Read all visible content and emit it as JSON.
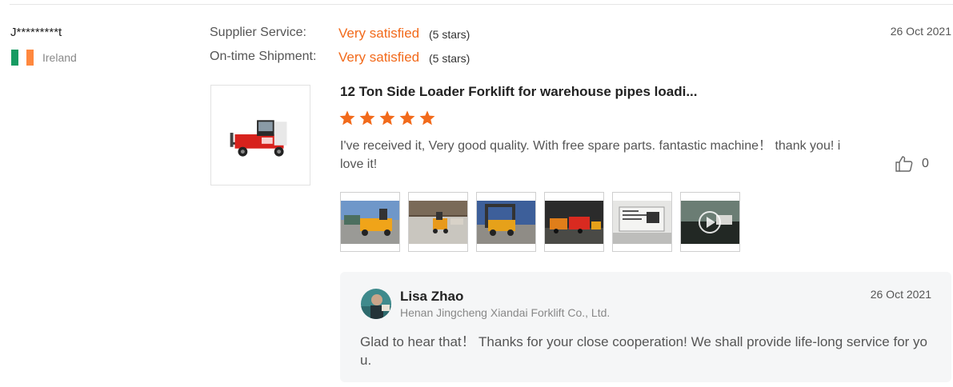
{
  "reviewer": {
    "name": "J*********t",
    "country": "Ireland",
    "flag_colors": [
      "#169b62",
      "#ffffff",
      "#ff883e"
    ]
  },
  "ratings": [
    {
      "label": "Supplier Service:",
      "value": "Very satisfied",
      "stars_text": "(5 stars)"
    },
    {
      "label": "On-time Shipment:",
      "value": "Very satisfied",
      "stars_text": "(5 stars)"
    }
  ],
  "review": {
    "date": "26 Oct 2021",
    "product_title": "12 Ton Side Loader Forklift for warehouse pipes loadi...",
    "star_count": 5,
    "comment": "I've received it, Very good quality. With free spare parts. fantastic machine！ thank you! i love it!",
    "likes": "0",
    "media_count": 6
  },
  "reply": {
    "name": "Lisa Zhao",
    "company": "Henan Jingcheng Xiandai Forklift Co., Ltd.",
    "date": "26 Oct 2021",
    "text": "Glad to hear that！  Thanks for your close cooperation! We shall provide life-long service for you."
  },
  "colors": {
    "accent": "#f26a1b",
    "star": "#f26a1b",
    "reply_bg": "#f5f6f7"
  },
  "icons": {
    "like": "thumbs-up-icon",
    "play": "play-icon",
    "star": "star-icon"
  }
}
